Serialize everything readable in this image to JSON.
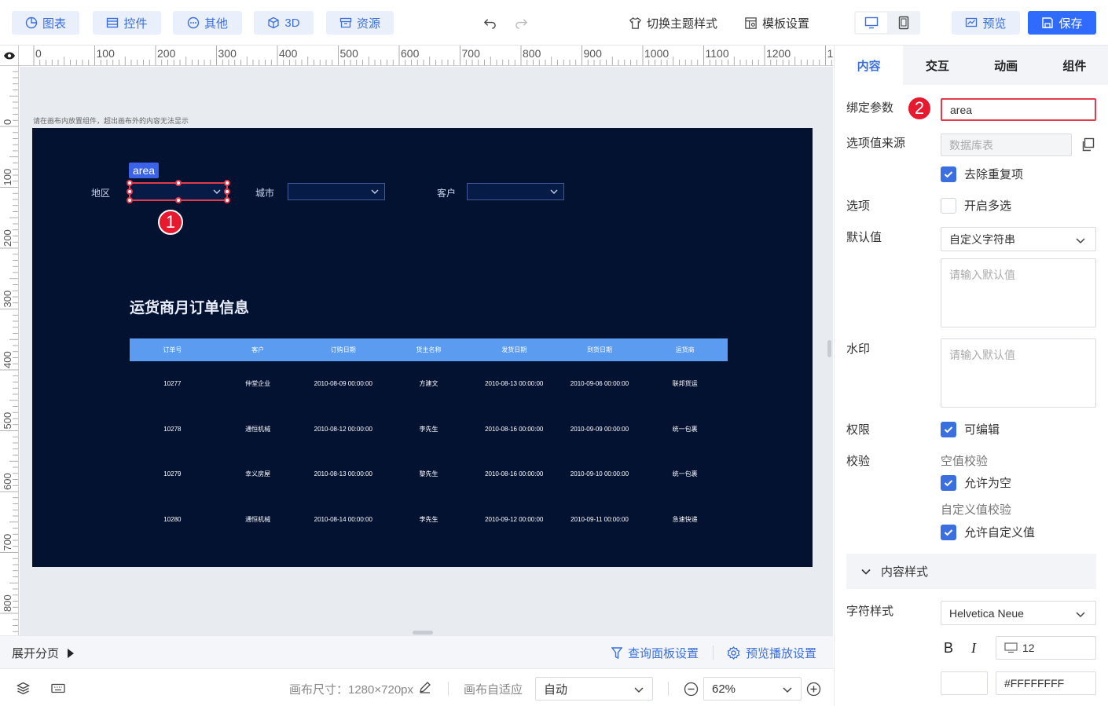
{
  "toolbar": {
    "left_buttons": [
      "图表",
      "控件",
      "其他",
      "3D",
      "资源"
    ],
    "theme_label": "切换主题样式",
    "template_label": "模板设置",
    "preview_label": "预览",
    "save_label": "保存"
  },
  "ruler": {
    "top_ticks": [
      "0",
      "100",
      "200",
      "300",
      "400",
      "500",
      "600",
      "700",
      "800",
      "900",
      "1000",
      "1100",
      "1200",
      "1"
    ],
    "left_ticks": [
      "0",
      "100",
      "200",
      "300",
      "400",
      "500",
      "600",
      "700",
      "800"
    ]
  },
  "canvas": {
    "hint": "请在画布内放置组件，超出画布外的内容无法显示",
    "filters": {
      "area_label": "地区",
      "city_label": "城市",
      "customer_label": "客户",
      "selected_tag": "area"
    },
    "badge1": "1",
    "title": "运货商月订单信息",
    "table": {
      "headers": [
        "订单号",
        "客户",
        "订购日期",
        "货主名称",
        "发货日期",
        "到货日期",
        "运货商"
      ],
      "rows": [
        [
          "10277",
          "仲堂企业",
          "2010-08-09 00:00:00",
          "方建文",
          "2010-08-13 00:00:00",
          "2010-09-06 00:00:00",
          "联邦货运"
        ],
        [
          "10278",
          "通恒机械",
          "2010-08-12 00:00:00",
          "李先生",
          "2010-08-16 00:00:00",
          "2010-09-09 00:00:00",
          "统一包裹"
        ],
        [
          "10279",
          "幸义房屋",
          "2010-08-13 00:00:00",
          "黎先生",
          "2010-08-16 00:00:00",
          "2010-09-10 00:00:00",
          "统一包裹"
        ],
        [
          "10280",
          "通恒机械",
          "2010-08-14 00:00:00",
          "李先生",
          "2010-09-12 00:00:00",
          "2010-09-11 00:00:00",
          "急速快递"
        ]
      ]
    }
  },
  "pagebar": {
    "expand_label": "展开分页",
    "query_settings": "查询面板设置",
    "preview_settings": "预览播放设置"
  },
  "statusbar": {
    "canvas_size_label": "画布尺寸：1280×720px",
    "adapt_label": "画布自适应",
    "adapt_value": "自动",
    "zoom_value": "62%"
  },
  "panel": {
    "tabs": [
      "内容",
      "交互",
      "动画",
      "组件"
    ],
    "bind_param_label": "绑定参数",
    "bind_param_value": "area",
    "badge2": "2",
    "source_label": "选项值来源",
    "source_placeholder": "数据库表",
    "dedupe_label": "去除重复项",
    "options_label": "选项",
    "multi_label": "开启多选",
    "default_label": "默认值",
    "default_type": "自定义字符串",
    "default_placeholder": "请输入默认值",
    "watermark_label": "水印",
    "watermark_placeholder": "请输入默认值",
    "permission_label": "权限",
    "editable_label": "可编辑",
    "validate_label": "校验",
    "empty_check_label": "空值校验",
    "allow_empty_label": "允许为空",
    "custom_check_label": "自定义值校验",
    "allow_custom_label": "允许自定义值",
    "content_style_label": "内容样式",
    "font_style_label": "字符样式",
    "font_family": "Helvetica Neue",
    "bold_label": "B",
    "italic_label": "I",
    "font_size": "12",
    "color_value": "#FFFFFFFF"
  }
}
